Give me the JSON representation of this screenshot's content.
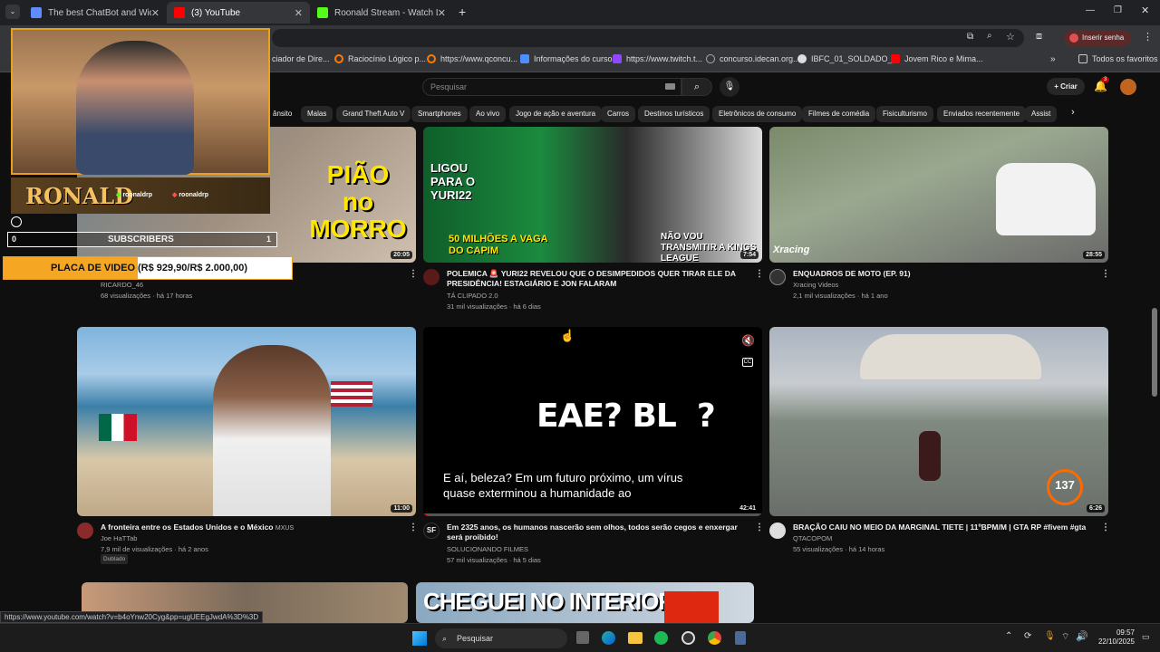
{
  "tabs": [
    {
      "label": "The best ChatBot and Widgets",
      "color": "#5f8dff"
    },
    {
      "label": "(3) YouTube",
      "color": "#ff0000"
    },
    {
      "label": "Roonald Stream - Watch Live o",
      "color": "#53fc18"
    }
  ],
  "address": {
    "profile_label": "Inserir senha"
  },
  "bookmarks": [
    {
      "label": "ciador de Dire...",
      "color": "#888888"
    },
    {
      "label": "Raciocínio Lógico p...",
      "color": "#ff7a00"
    },
    {
      "label": "https://www.qconcu...",
      "color": "#ff7a00"
    },
    {
      "label": "Informações do curso",
      "color": "#4c8dff"
    },
    {
      "label": "https://www.twitch.t...",
      "color": "#9146ff"
    },
    {
      "label": "concurso.idecan.org...",
      "color": "#aaaaaa"
    },
    {
      "label": "IBFC_01_SOLDADO_...",
      "color": "#dddddd"
    },
    {
      "label": "Jovem Rico e Mima...",
      "color": "#ff0000"
    }
  ],
  "bookmarks_right": "Todos os favoritos",
  "yt": {
    "search_placeholder": "Pesquisar",
    "create_label": "Criar",
    "notif_count": "3"
  },
  "chips": [
    "ânsito",
    "Malas",
    "Grand Theft Auto V",
    "Smartphones",
    "Ao vivo",
    "Jogo de ação e aventura",
    "Carros",
    "Destinos turísticos",
    "Eletrônicos de consumo",
    "Filmes de comédia",
    "Fisiculturismo",
    "Enviados recentemente",
    "Assist"
  ],
  "overlay": {
    "name": "RONALD",
    "handle1": "roonaldrp",
    "handle2": "roonaldrp",
    "sub_count_left": "0",
    "subscribers_label": "SUBSCRIBERS",
    "sub_count_right": "1",
    "goal_label": "PLACA DE VIDEO",
    "goal_value": "(R$ 929,90/R$ 2.000,00)"
  },
  "videos": [
    {
      "title": "",
      "channel": "RICARDO_46",
      "meta": "68 visualizações · há 17 horas",
      "duration": "20:05",
      "thumb_text": "PIÃO no MORRO"
    },
    {
      "title": "POLEMICA 🚨 YURI22 REVELOU QUE O DESIMPEDIDOS QUER TIRAR ELE DA PRESIDÊNCIA! ESTAGIÁRIO E JON FALARAM",
      "channel": "TÁ CLIPADO 2.0",
      "meta": "31 mil visualizações · há 6 dias",
      "duration": "7:54",
      "thumb_text_1": "LIGOU PARA O YURI22",
      "thumb_text_2": "50 MILHÕES A VAGA DO CAPIM",
      "thumb_text_3": "NÃO VOU TRANSMITIR A KINGS LEAGUE"
    },
    {
      "title": "ENQUADROS DE MOTO (EP. 91)",
      "channel": "Xracing Videos",
      "meta": "2,1 mil visualizações · há 1 ano",
      "duration": "28:55",
      "thumb_text": "Xracing"
    },
    {
      "title": "A fronteira entre os Estados Unidos e o México",
      "title_suffix": "MXUS",
      "channel": "Joe HaTTab",
      "meta": "7,9 mil de visualizações · há 2 anos",
      "badge": "Dublado",
      "duration": "11:00"
    },
    {
      "title": "Em 2325 anos, os humanos nascerão sem olhos, todos serão cegos e enxergar será proibido!",
      "channel": "SOLUCIONANDO FILMES",
      "meta": "57 mil visualizações · há 5 dias",
      "duration": "42:41",
      "thumb_text": "EAE? BL  ?",
      "caption": "E aí, beleza? Em um futuro próximo, um vírus quase exterminou a humanidade ao"
    },
    {
      "title": "BRAÇÃO CAIU NO MEIO DA MARGINAL TIETE | 11ºBPM/M | GTA RP #fivem  #gta",
      "channel": "QTACOPOM",
      "meta": "55 visualizações · há 14 horas",
      "duration": "6:26",
      "speed": "137"
    },
    {
      "thumb_text": "CHEGUEI NO INTERIOR"
    }
  ],
  "status_url": "https://www.youtube.com/watch?v=b4oYnw20Cyg&pp=ugUEEgJwdA%3D%3D",
  "taskbar": {
    "search_label": "Pesquisar",
    "time": "09:57",
    "date": "22/10/2025"
  }
}
